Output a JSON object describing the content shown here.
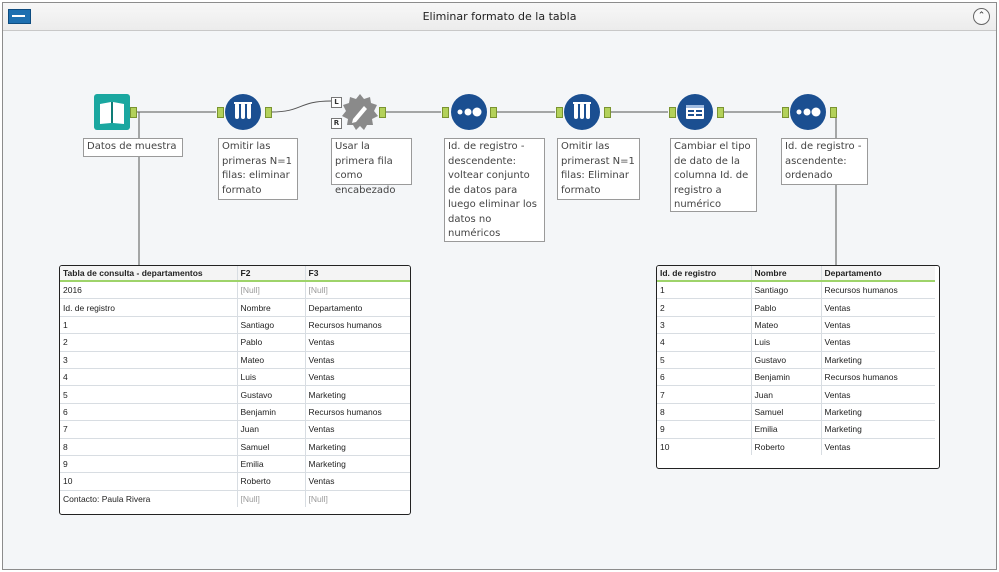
{
  "window": {
    "title": "Eliminar formato de la tabla",
    "collapse_glyph": "⌃"
  },
  "tools": [
    {
      "name": "Datos de muestra",
      "icon": "book-icon",
      "color": "#1aa7a0"
    },
    {
      "name": "Omitir las primeras N=1 filas: eliminar formato",
      "icon": "test-tubes-icon",
      "color": "#1b4f91"
    },
    {
      "name": "Usar la primera fila como encabezado",
      "icon": "dynamic-rename-icon",
      "color": "#8a8a8a",
      "anchors": [
        "L",
        "R"
      ]
    },
    {
      "name": "Id. de registro - descendente: voltear conjunto de datos para luego eliminar los datos no numéricos",
      "icon": "three-dots-icon",
      "color": "#1b4f91"
    },
    {
      "name": "Omitir las primerast N=1 filas: Eliminar formato",
      "icon": "test-tubes-icon",
      "color": "#1b4f91"
    },
    {
      "name": "Cambiar el tipo de dato de la columna Id. de registro a numérico",
      "icon": "select-icon",
      "color": "#1b4f91"
    },
    {
      "name": "Id. de registro - ascendente: ordenado",
      "icon": "three-dots-icon",
      "color": "#1b4f91"
    }
  ],
  "table_left": {
    "headers": [
      "Tabla de consulta - departamentos",
      "F2",
      "F3"
    ],
    "rows": [
      [
        "2016",
        "[Null]",
        "[Null]"
      ],
      [
        "Id. de registro",
        "Nombre",
        "Departamento"
      ],
      [
        "1",
        "Santiago",
        "Recursos humanos"
      ],
      [
        "2",
        "Pablo",
        "Ventas"
      ],
      [
        "3",
        "Mateo",
        "Ventas"
      ],
      [
        "4",
        "Luis",
        "Ventas"
      ],
      [
        "5",
        "Gustavo",
        "Marketing"
      ],
      [
        "6",
        "Benjamin",
        "Recursos humanos"
      ],
      [
        "7",
        "Juan",
        "Ventas"
      ],
      [
        "8",
        "Samuel",
        "Marketing"
      ],
      [
        "9",
        "Emilia",
        "Marketing"
      ],
      [
        "10",
        "Roberto",
        "Ventas"
      ],
      [
        "Contacto: Paula Rivera",
        "[Null]",
        "[Null]"
      ]
    ]
  },
  "table_right": {
    "headers": [
      "Id. de registro",
      "Nombre",
      "Departamento"
    ],
    "rows": [
      [
        "1",
        "Santiago",
        "Recursos humanos"
      ],
      [
        "2",
        "Pablo",
        "Ventas"
      ],
      [
        "3",
        "Mateo",
        "Ventas"
      ],
      [
        "4",
        "Luis",
        "Ventas"
      ],
      [
        "5",
        "Gustavo",
        "Marketing"
      ],
      [
        "6",
        "Benjamin",
        "Recursos humanos"
      ],
      [
        "7",
        "Juan",
        "Ventas"
      ],
      [
        "8",
        "Samuel",
        "Marketing"
      ],
      [
        "9",
        "Emilia",
        "Marketing"
      ],
      [
        "10",
        "Roberto",
        "Ventas"
      ]
    ]
  },
  "colors": {
    "anchor": "#b3d15a",
    "wire": "#555555",
    "header_underline": "#9ed36a"
  }
}
